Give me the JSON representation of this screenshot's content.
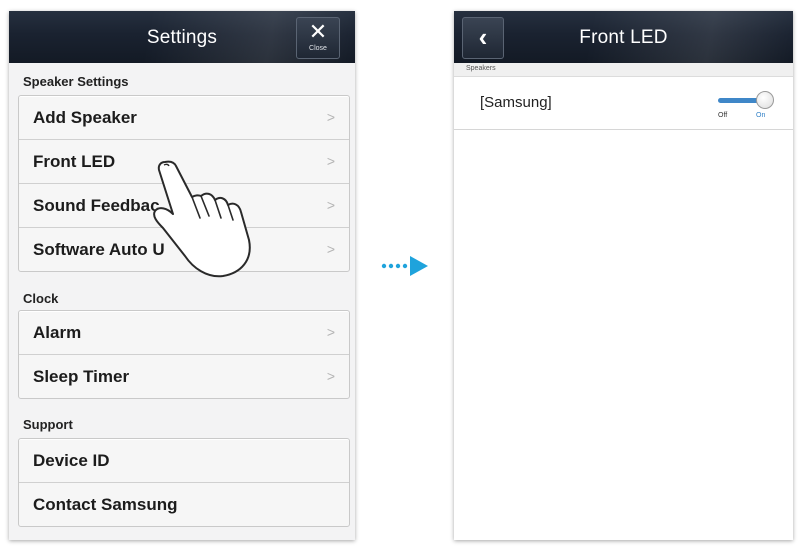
{
  "settings": {
    "title": "Settings",
    "close_label": "Close",
    "close_glyph": "✕",
    "sections": [
      {
        "header": "Speaker Settings",
        "items": [
          {
            "label": "Add Speaker"
          },
          {
            "label": "Front LED"
          },
          {
            "label": "Sound Feedbac"
          },
          {
            "label": "Software Auto U"
          }
        ]
      },
      {
        "header": "Clock",
        "items": [
          {
            "label": "Alarm"
          },
          {
            "label": "Sleep Timer"
          }
        ]
      },
      {
        "header": "Support",
        "items": [
          {
            "label": "Device ID"
          },
          {
            "label": "Contact Samsung"
          }
        ]
      }
    ]
  },
  "front_led": {
    "title": "Front LED",
    "back_glyph": "‹",
    "section_header": "Speakers",
    "device_name": "[Samsung]",
    "toggle": {
      "off_label": "Off",
      "on_label": "On",
      "state": "on"
    }
  },
  "icons": {
    "close": "close-icon",
    "back": "back-chevron-icon",
    "row_chevron": "chevron-right-icon",
    "pointer": "hand-pointer-icon",
    "flow": "dotted-arrow-icon"
  },
  "colors": {
    "titlebar": "#1a2230",
    "toggle_accent": "#3f87c8",
    "flow_arrow": "#1fa3dc"
  }
}
